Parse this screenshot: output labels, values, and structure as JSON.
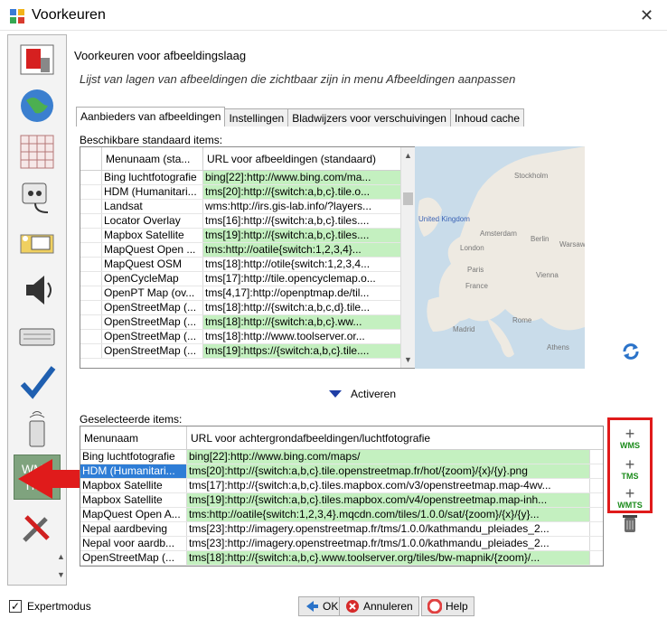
{
  "window": {
    "title": "Voorkeuren"
  },
  "main": {
    "heading": "Voorkeuren voor afbeeldingslaag",
    "subheading": "Lijst van lagen van afbeeldingen die zichtbaar zijn in menu Afbeeldingen aanpassen"
  },
  "tabs": [
    {
      "label": "Aanbieders van afbeeldingen"
    },
    {
      "label": "Instellingen"
    },
    {
      "label": "Bladwijzers voor verschuivingen"
    },
    {
      "label": "Inhoud cache"
    }
  ],
  "available": {
    "label": "Beschikbare standaard items:",
    "col1": "Menunaam (sta...",
    "col2": "URL voor afbeeldingen (standaard)",
    "rows": [
      {
        "name": "Bing luchtfotografie",
        "url": "bing[22]:http://www.bing.com/ma...",
        "green": true
      },
      {
        "name": "HDM (Humanitari...",
        "url": "tms[20]:http://{switch:a,b,c}.tile.o...",
        "green": true
      },
      {
        "name": "Landsat",
        "url": "wms:http://irs.gis-lab.info/?layers...",
        "green": false
      },
      {
        "name": "Locator Overlay",
        "url": "tms[16]:http://{switch:a,b,c}.tiles....",
        "green": false
      },
      {
        "name": "Mapbox Satellite",
        "url": "tms[19]:http://{switch:a,b,c}.tiles....",
        "green": true
      },
      {
        "name": "MapQuest Open ...",
        "url": "tms:http://oatile{switch:1,2,3,4}...",
        "green": true
      },
      {
        "name": "MapQuest OSM",
        "url": "tms[18]:http://otile{switch:1,2,3,4...",
        "green": false
      },
      {
        "name": "OpenCycleMap",
        "url": "tms[17]:http://tile.opencyclemap.o...",
        "green": false
      },
      {
        "name": "OpenPT Map (ov...",
        "url": "tms[4,17]:http://openptmap.de/til...",
        "green": false
      },
      {
        "name": "OpenStreetMap (...",
        "url": "tms[18]:http://{switch:a,b,c,d}.tile...",
        "green": false
      },
      {
        "name": "OpenStreetMap (...",
        "url": "tms[18]:http://{switch:a,b,c}.ww...",
        "green": true
      },
      {
        "name": "OpenStreetMap (...",
        "url": "tms[18]:http://www.toolserver.or...",
        "green": false
      },
      {
        "name": "OpenStreetMap (...",
        "url": "tms[19]:https://{switch:a,b,c}.tile....",
        "green": true
      }
    ]
  },
  "activate_label": "Activeren",
  "selected": {
    "label": "Geselecteerde items:",
    "col1": "Menunaam",
    "col2": "URL voor achtergrondafbeeldingen/luchtfotografie",
    "rows": [
      {
        "name": "Bing luchtfotografie",
        "url": "bing[22]:http://www.bing.com/maps/",
        "green": true,
        "selected": false
      },
      {
        "name": "HDM (Humanitari...",
        "url": "tms[20]:http://{switch:a,b,c}.tile.openstreetmap.fr/hot/{zoom}/{x}/{y}.png",
        "green": true,
        "selected": true
      },
      {
        "name": "Mapbox Satellite",
        "url": "tms[17]:http://{switch:a,b,c}.tiles.mapbox.com/v3/openstreetmap.map-4wv...",
        "green": false,
        "selected": false
      },
      {
        "name": "Mapbox Satellite",
        "url": "tms[19]:http://{switch:a,b,c}.tiles.mapbox.com/v4/openstreetmap.map-inh...",
        "green": true,
        "selected": false
      },
      {
        "name": "MapQuest Open A...",
        "url": "tms:http://oatile{switch:1,2,3,4}.mqcdn.com/tiles/1.0.0/sat/{zoom}/{x}/{y}...",
        "green": true,
        "selected": false
      },
      {
        "name": "Nepal aardbeving",
        "url": "tms[23]:http://imagery.openstreetmap.fr/tms/1.0.0/kathmandu_pleiades_2...",
        "green": false,
        "selected": false
      },
      {
        "name": "Nepal voor aardb...",
        "url": "tms[23]:http://imagery.openstreetmap.fr/tms/1.0.0/kathmandu_pleiades_2...",
        "green": false,
        "selected": false
      },
      {
        "name": "OpenStreetMap (...",
        "url": "tms[18]:http://{switch:a,b,c}.www.toolserver.org/tiles/bw-mapnik/{zoom}/...",
        "green": true,
        "selected": false
      }
    ]
  },
  "map_labels": [
    "Stockholm",
    "United Kingdom",
    "Amsterdam",
    "Berlin",
    "Warsaw",
    "London",
    "Paris",
    "Vienna",
    "France",
    "Madrid",
    "Rome",
    "Athens"
  ],
  "side_buttons": {
    "wms": "WMS",
    "tms": "TMS",
    "wmts": "WMTS"
  },
  "sidebar_wms": {
    "line1": "WMS",
    "line2": "TMS"
  },
  "footer": {
    "expert_label": "Expertmodus",
    "ok": "OK",
    "cancel": "Annuleren",
    "help": "Help"
  }
}
